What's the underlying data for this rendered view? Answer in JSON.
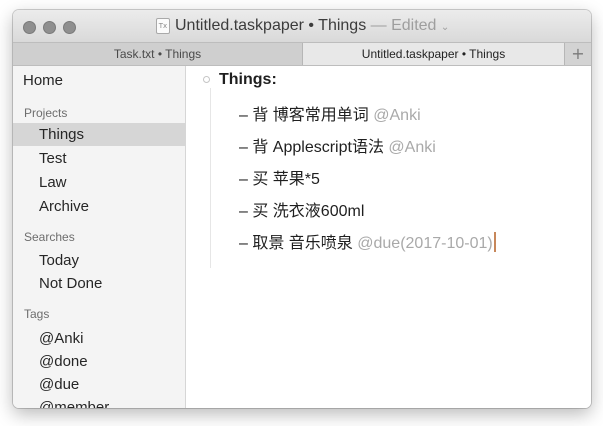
{
  "window": {
    "doc_icon": "Tx",
    "title": "Untitled.taskpaper • Things",
    "edited": " — Edited",
    "edited_chevron": "⌄"
  },
  "tabs": [
    {
      "label": "Task.txt • Things",
      "active": false
    },
    {
      "label": "Untitled.taskpaper • Things",
      "active": true
    }
  ],
  "tab_add_label": "+",
  "sidebar": {
    "home": "Home",
    "projects_header": "Projects",
    "projects": [
      "Things",
      "Test",
      "Law",
      "Archive"
    ],
    "selected_project": "Things",
    "searches_header": "Searches",
    "searches": [
      "Today",
      "Not Done"
    ],
    "tags_header": "Tags",
    "tags": [
      "@Anki",
      "@done",
      "@due",
      "@member"
    ]
  },
  "editor": {
    "project": "Things:",
    "tasks": [
      {
        "text": "– 背 博客常用单词",
        "tag": "@Anki"
      },
      {
        "text": "– 背 Applescript语法",
        "tag": "@Anki"
      },
      {
        "text": "– 买 苹果*5",
        "tag": ""
      },
      {
        "text": "– 买 洗衣液600ml",
        "tag": ""
      },
      {
        "text": "– 取景 音乐喷泉",
        "tag": "@due(2017-10-01)"
      }
    ]
  },
  "colors": {
    "tag_text": "#a9a9a9",
    "selection": "#d6d6d6",
    "caret": "#c7875a"
  }
}
